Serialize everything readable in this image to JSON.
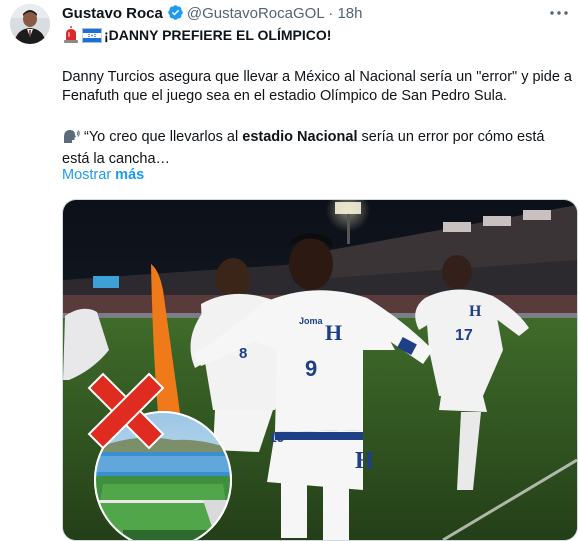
{
  "tweet": {
    "author_name": "Gustavo Roca",
    "handle": "@GustavoRocaGOL",
    "separator": "·",
    "time": "18h",
    "headline": "¡DANNY PREFIERE EL OLÍMPICO!",
    "body": "Danny Turcios asegura que llevar a México al Nacional sería un \"error\" y pide a Fenafuth que el juego sea en el estadio Olímpico de San Pedro Sula.",
    "quote_start": "“Yo creo que llevarlos al ",
    "quote_bold": "estadio Nacional",
    "quote_end": " sería un error por cómo está está la cancha…",
    "show_more_a": "Mostrar ",
    "show_more_b": "más"
  },
  "media": {
    "jersey_brand": "Joma",
    "numbers": [
      "8",
      "9",
      "17",
      "19"
    ],
    "crest_letter": "H"
  },
  "colors": {
    "verified_badge": "#1d9bf0",
    "link": "#1d9bf0",
    "secondary_text": "#536471",
    "cross": "#e02b20"
  },
  "icons": [
    "verified-badge-icon",
    "more-options-icon",
    "siren-emoji-icon",
    "honduras-flag-icon",
    "speaking-head-emoji-icon",
    "red-cross-icon"
  ]
}
